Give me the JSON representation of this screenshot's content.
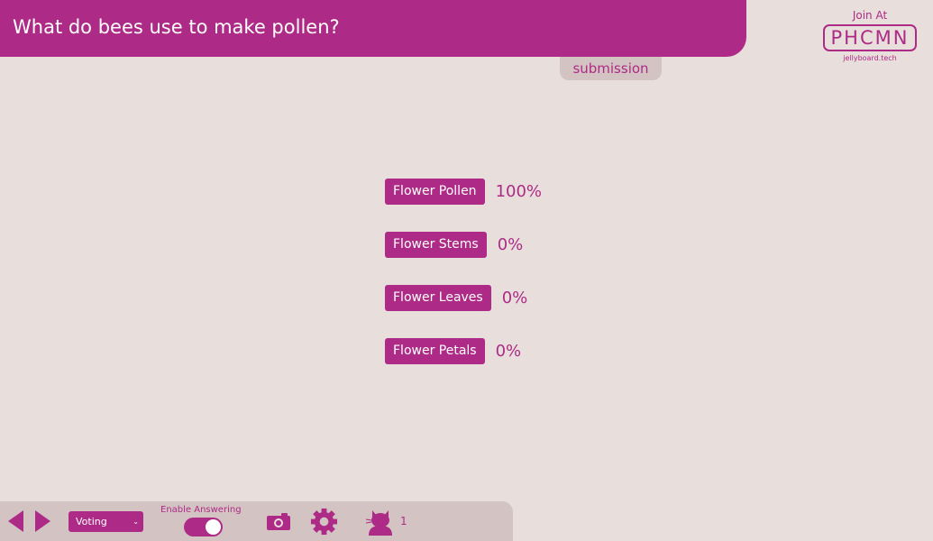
{
  "header": {
    "question": "What do bees use to make pollen?"
  },
  "mode_tag": "submission",
  "join": {
    "join_at": "Join At",
    "room_code": "PHCMN",
    "url": "jellyboard.tech"
  },
  "answers": [
    {
      "label": "Flower Pollen",
      "percent": "100%"
    },
    {
      "label": "Flower Stems",
      "percent": "0%"
    },
    {
      "label": "Flower Leaves",
      "percent": "0%"
    },
    {
      "label": "Flower Petals",
      "percent": "0%"
    }
  ],
  "toolbar": {
    "mode_select_value": "Voting",
    "enable_label": "Enable Answering",
    "toggle_on": true,
    "user_count": "1",
    "icons": [
      "prev-arrow-icon",
      "next-arrow-icon",
      "camera-icon",
      "gear-icon",
      "user-avatar-icon"
    ]
  },
  "colors": {
    "accent": "#ad2b86",
    "background": "#e8dedc",
    "panel": "#d3c3c2"
  }
}
